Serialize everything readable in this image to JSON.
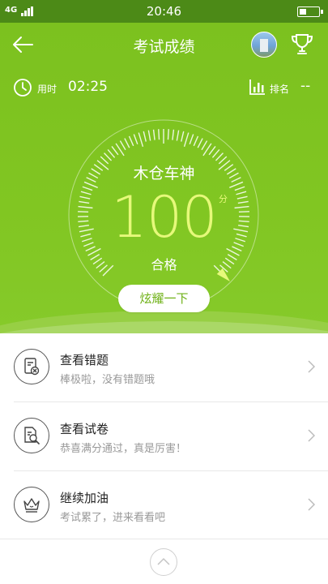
{
  "status_bar": {
    "network": "4G",
    "time": "20:46"
  },
  "title_bar": {
    "title": "考试成绩"
  },
  "stats": {
    "time_label": "用时",
    "time_value": "02:25",
    "rank_label": "排名",
    "rank_value": "--"
  },
  "result": {
    "user_name": "木仓车神",
    "score": "100",
    "score_unit": "分",
    "status": "合格",
    "score_fraction": 1.0
  },
  "share_button": {
    "label": "炫耀一下"
  },
  "menu": [
    {
      "title": "查看错题",
      "subtitle": "棒极啦，没有错题哦",
      "icon": "wrong-questions-icon"
    },
    {
      "title": "查看试卷",
      "subtitle": "恭喜满分通过，真是厉害！",
      "icon": "exam-paper-icon"
    },
    {
      "title": "继续加油",
      "subtitle": "考试累了，进来看看吧",
      "icon": "crown-icon"
    }
  ],
  "colors": {
    "theme_green": "#7cc11f",
    "score_yellow": "#e6f97a",
    "status_bar": "#4c8a17"
  }
}
